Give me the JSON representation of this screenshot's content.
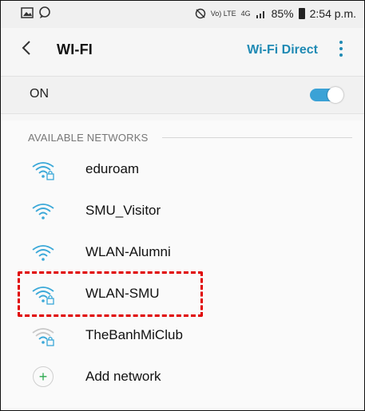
{
  "status_bar": {
    "lte": "Vo) LTE",
    "signal_label": "4G",
    "battery": "85%",
    "time": "2:54 p.m."
  },
  "app_bar": {
    "title": "WI-FI",
    "wifi_direct": "Wi-Fi Direct"
  },
  "toggle_row": {
    "label": "ON",
    "state": true,
    "accent": "#3ba2d6"
  },
  "networks": {
    "header": "AVAILABLE NETWORKS",
    "items": [
      {
        "name": "eduroam",
        "locked": true,
        "signal": "strong"
      },
      {
        "name": "SMU_Visitor",
        "locked": false,
        "signal": "strong"
      },
      {
        "name": "WLAN-Alumni",
        "locked": false,
        "signal": "strong"
      },
      {
        "name": "WLAN-SMU",
        "locked": true,
        "signal": "strong"
      },
      {
        "name": "TheBanhMiClub",
        "locked": true,
        "signal": "weak"
      }
    ],
    "add_network": "Add network"
  },
  "colors": {
    "accent_blue": "#1f8ab4",
    "wifi_icon": "#3aa8d8",
    "wifi_weak": "#b8b8b8",
    "add_green": "#2eaa50",
    "highlight_red": "#e00000"
  }
}
